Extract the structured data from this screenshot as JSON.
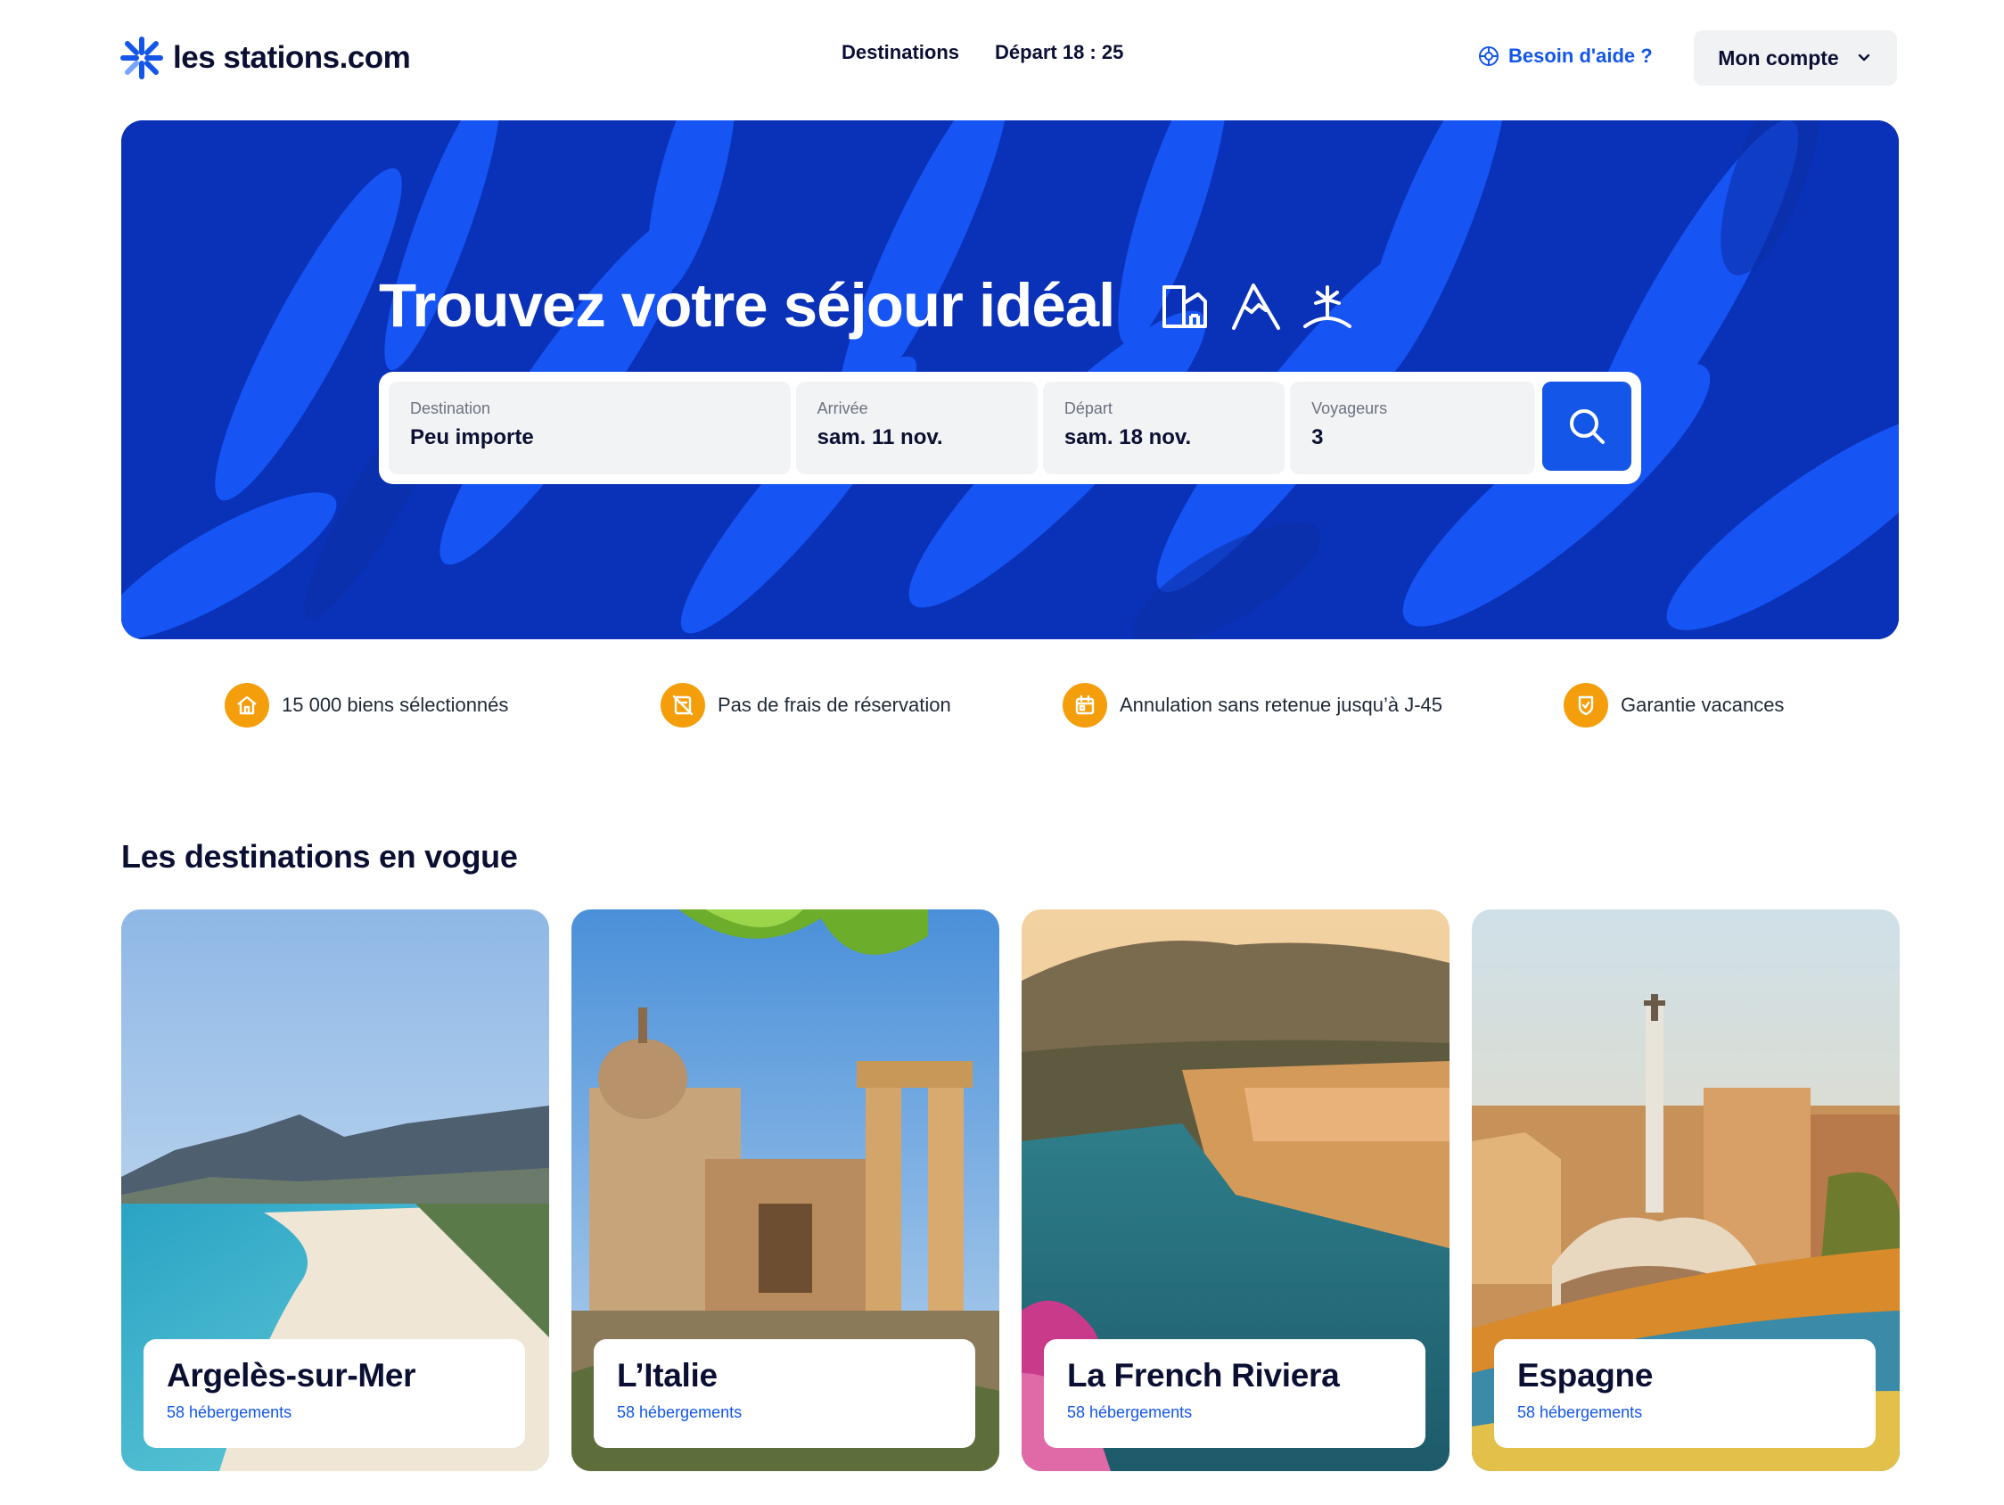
{
  "brand": {
    "name": "les stations.com",
    "color": "#1356e8"
  },
  "nav": [
    {
      "label": "Destinations"
    },
    {
      "label": "Départ 18 : 25"
    }
  ],
  "help": {
    "label": "Besoin d'aide ?",
    "icon": "help-wheel-icon"
  },
  "account": {
    "label": "Mon compte",
    "icon": "chevron-down-icon"
  },
  "hero": {
    "title": "Trouvez votre séjour idéal",
    "icons": [
      "city-icon",
      "mountain-icon",
      "palm-island-icon"
    ]
  },
  "search": {
    "destination": {
      "label": "Destination",
      "value": "Peu importe"
    },
    "arrival": {
      "label": "Arrivée",
      "value": "sam. 11 nov."
    },
    "departure": {
      "label": "Départ",
      "value": "sam. 18 nov."
    },
    "travelers": {
      "label": "Voyageurs",
      "value": "3"
    },
    "button_icon": "search-icon"
  },
  "features": [
    {
      "label": "15 000 biens sélectionnés",
      "icon": "house-icon"
    },
    {
      "label": "Pas de frais de réservation",
      "icon": "no-fee-icon"
    },
    {
      "label": "Annulation sans retenue jusqu’à J-45",
      "icon": "calendar-icon"
    },
    {
      "label": "Garantie vacances",
      "icon": "shield-check-icon"
    }
  ],
  "section": {
    "title": "Les destinations en vogue"
  },
  "destinations": [
    {
      "name": "Argelès-sur-Mer",
      "count": "58 hébergements"
    },
    {
      "name": "L’Italie",
      "count": "58 hébergements"
    },
    {
      "name": "La French Riviera",
      "count": "58 hébergements"
    },
    {
      "name": "Espagne",
      "count": "58 hébergements"
    }
  ],
  "colors": {
    "accent": "#1356e8",
    "hero_bg": "#0b3bd6",
    "feature_icon_bg": "#f59e0b",
    "text_dark": "#0b1033"
  }
}
